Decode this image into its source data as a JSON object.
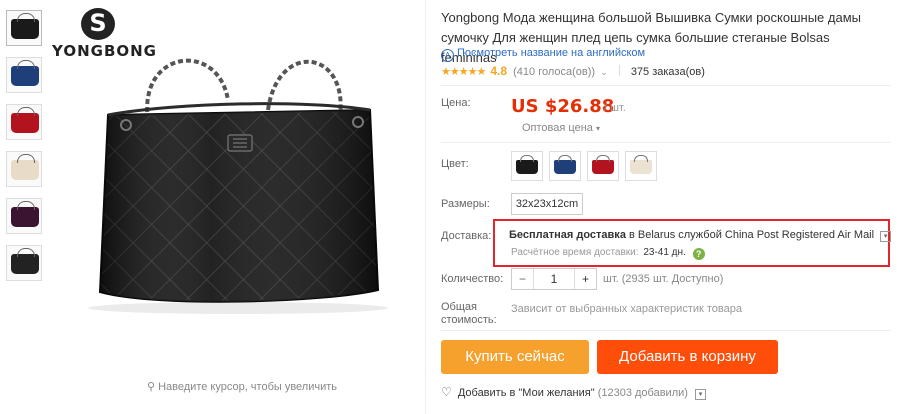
{
  "brand": {
    "logo_text": "YONGBONG"
  },
  "gallery": {
    "thumbnails": [
      {
        "name": "black",
        "color": "#1a1a1a"
      },
      {
        "name": "blue",
        "color": "#1f3f7a"
      },
      {
        "name": "red",
        "color": "#b3121f"
      },
      {
        "name": "beige",
        "color": "#e8dcc8"
      },
      {
        "name": "purple",
        "color": "#3a1430"
      },
      {
        "name": "black-side",
        "color": "#222222"
      }
    ],
    "zoom_hint": "Наведите курсор, чтобы увеличить"
  },
  "product": {
    "title": "Yongbong Мода женщина большой Вышивка Сумки роскошные дамы сумочку Для женщин плед цепь сумка большие стеганые Bolsas femininas",
    "translate_link": "Посмотреть название на английском",
    "rating": {
      "stars": "★★★★★",
      "value": "4.8",
      "votes": "(410 голоса(ов))",
      "score_fraction": 0.96
    },
    "orders": "375 заказа(ов)"
  },
  "price": {
    "label": "Цена:",
    "value": "US $26.88",
    "unit": "/ шт.",
    "wholesale": "Оптовая цена"
  },
  "color": {
    "label": "Цвет:",
    "options": [
      {
        "name": "black",
        "hex": "#1a1a1a"
      },
      {
        "name": "blue",
        "hex": "#1f3f7a"
      },
      {
        "name": "red",
        "hex": "#b3121f"
      },
      {
        "name": "beige",
        "hex": "#ece2d2"
      }
    ]
  },
  "size": {
    "label": "Размеры:",
    "value": "32x23x12cm"
  },
  "shipping": {
    "label": "Доставка:",
    "free": "Бесплатная доставка",
    "to": "в Belarus службой China Post Registered Air Mail",
    "time_label": "Расчётное время доставки:",
    "time_value": "23-41 дн.",
    "highlight_color": "#e3262d"
  },
  "quantity": {
    "label": "Количество:",
    "value": "1",
    "minus": "−",
    "plus": "+",
    "available": "шт. (2935 шт. Доступно)"
  },
  "total": {
    "label_line1": "Общая",
    "label_line2": "стоимость:",
    "text": "Зависит от выбранных характеристик товара"
  },
  "actions": {
    "buy_now": "Купить сейчас",
    "add_to_cart": "Добавить в корзину",
    "buy_color": "#f6a02d",
    "cart_color": "#ff4e0a"
  },
  "wishlist": {
    "text": "Добавить в \"Мои желания\"",
    "count": "(12303 добавили)"
  },
  "icons": {
    "translate": "translate-icon",
    "heart": "heart-icon",
    "help": "help-icon",
    "search": "magnifier-icon",
    "dropdown": "chevron-down-icon"
  }
}
